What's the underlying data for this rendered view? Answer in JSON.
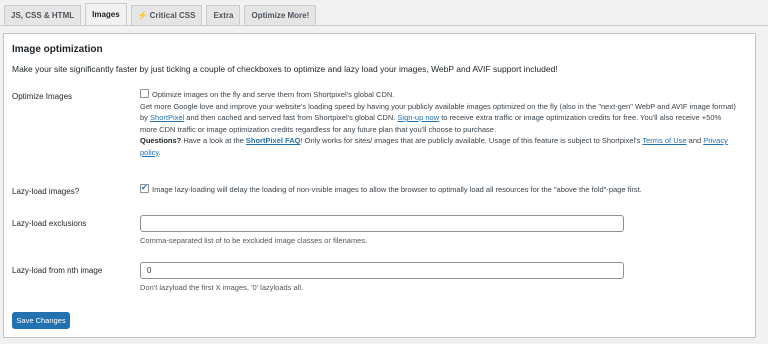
{
  "tabs": [
    {
      "label": "JS, CSS & HTML",
      "active": false
    },
    {
      "label": "Images",
      "active": true
    },
    {
      "label": "Critical CSS",
      "active": false,
      "icon": "bolt-icon"
    },
    {
      "label": "Extra",
      "active": false
    },
    {
      "label": "Optimize More!",
      "active": false
    }
  ],
  "section": {
    "title": "Image optimization",
    "intro": "Make your site significantly faster by just ticking a couple of checkboxes to optimize and lazy load your images, WebP and AVIF support included!"
  },
  "optimize_images": {
    "label": "Optimize Images",
    "checkbox_label": "Optimize images on the fly and serve them from Shortpixel's global CDN.",
    "checked": false,
    "desc_1": "Get more Google love and improve your website's loading speed by having your publicly available images optimized on the fly (also in the \"next-gen\" WebP and AVIF image format) by ",
    "link_shortpixel": "ShortPixel",
    "desc_2": " and then cached and served fast from Shortpixel's global CDN. ",
    "link_signup": "Sign-up now",
    "desc_3": " to receive extra traffic or image optimization credits for free. You'll also receive +50% more CDN traffic or image optimization credits regardless for any future plan that you'll choose to purchase.",
    "questions_label": "Questions?",
    "q_text_1": " Have a look at the ",
    "link_faq": "ShortPixel FAQ",
    "q_text_2": "! Only works for sites/ images that are publicly available. Usage of this feature is subject to Shortpixel's ",
    "link_terms": "Terms of Use",
    "q_text_3": " and ",
    "link_privacy": "Privacy policy",
    "q_text_4": "."
  },
  "lazyload": {
    "label": "Lazy-load images?",
    "checkbox_label": "Image lazy-loading will delay the loading of non-visible images to allow the browser to optimally load all resources for the \"above the fold\"-page first.",
    "checked": true
  },
  "lazyload_exclusions": {
    "label": "Lazy-load exclusions",
    "value": "",
    "description": "Comma-separated list of to be excluded image classes or filenames."
  },
  "lazyload_nth": {
    "label": "Lazy-load from nth image",
    "value": "0",
    "description": "Don't lazyload the first X images, '0' lazyloads all."
  },
  "save_button": {
    "label": "Save Changes"
  },
  "colors": {
    "accent": "#2271b1",
    "bolt": "#e8a10f"
  }
}
